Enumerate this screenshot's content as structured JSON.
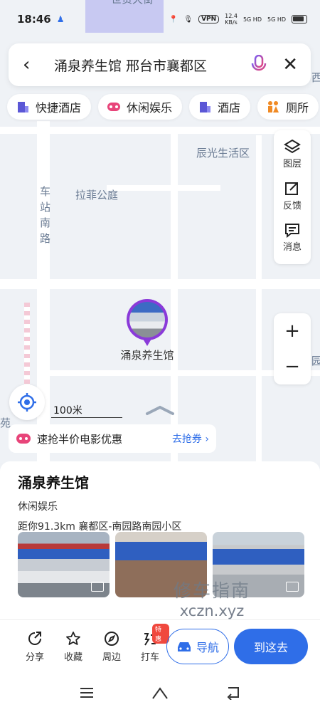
{
  "status_bar": {
    "time": "18:46",
    "vpn": "VPN",
    "net_speed": "12.4",
    "net_unit": "KB/s",
    "sig1": "5G HD",
    "sig2": "5G HD"
  },
  "search": {
    "query": "涌泉养生馆 邢台市襄都区"
  },
  "chips": [
    {
      "label": "快捷酒店",
      "icon": "building-icon",
      "color": "#5b57d6"
    },
    {
      "label": "休闲娱乐",
      "icon": "gamepad-icon",
      "color": "#e8457a"
    },
    {
      "label": "酒店",
      "icon": "building-icon",
      "color": "#5b57d6"
    },
    {
      "label": "厕所",
      "icon": "toilet-icon",
      "color": "#f08a24"
    }
  ],
  "tools": {
    "layers": "图层",
    "feedback": "反馈",
    "messages": "消息"
  },
  "map": {
    "labels": {
      "top": "世贸天街",
      "district": "辰光生活区",
      "road": "车站南路",
      "park": "拉菲公庭",
      "edge_top": "西",
      "edge_right": "园",
      "edge_left": "苑"
    },
    "marker_label": "涌泉养生馆",
    "scale": "100米"
  },
  "promo": {
    "text": "速抢半价电影优惠",
    "link": "去抢券 ›"
  },
  "place": {
    "name": "涌泉养生馆",
    "category": "休闲娱乐",
    "distance_address": "距你91.3km  襄都区-南园路南园小区"
  },
  "watermark": {
    "line1": "修车指南",
    "line2": "xczn.xyz"
  },
  "actions": {
    "share": "分享",
    "favorite": "收藏",
    "nearby": "周边",
    "taxi": "打车",
    "taxi_badge": "特惠",
    "navigate": "导航",
    "go_here": "到这去"
  },
  "colors": {
    "accent": "#2f6ee8",
    "marker": "#8a3ad9"
  }
}
